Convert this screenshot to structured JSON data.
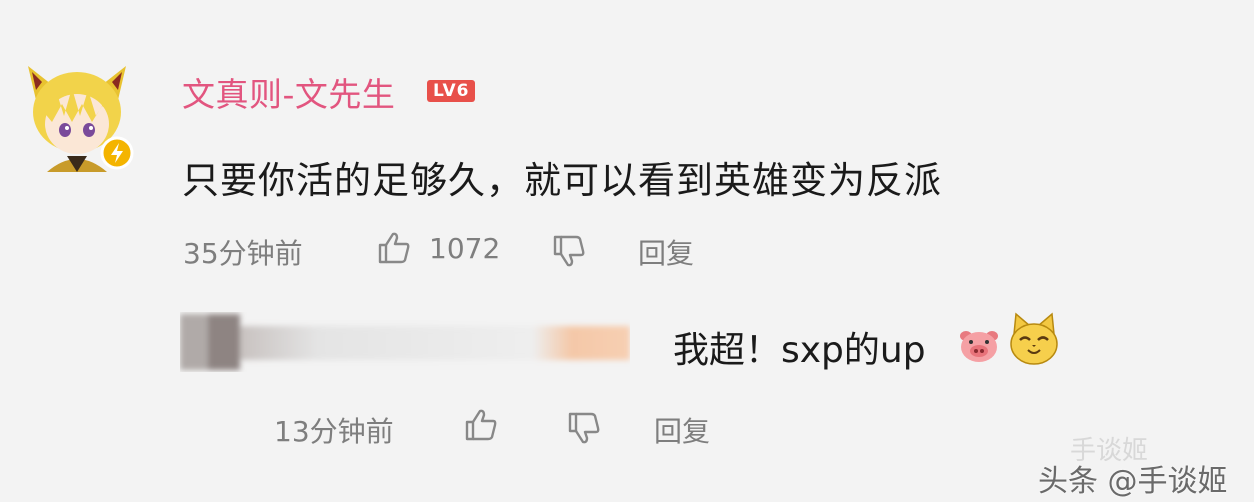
{
  "comment": {
    "username": "文真则-文先生",
    "level_badge": "LV6",
    "text": "只要你活的足够久，就可以看到英雄变为反派",
    "time": "35分钟前",
    "like_count": "1072",
    "reply_label": "回复"
  },
  "reply": {
    "text": "我超！sxp的up",
    "time": "13分钟前",
    "reply_label": "回复",
    "emojis": [
      "pig-face-emoji",
      "cat-face-emoji"
    ]
  },
  "watermark": {
    "secondary": "手谈姬",
    "main": "头条 @手谈姬"
  },
  "colors": {
    "background": "#f3f3f3",
    "username": "#e2557f",
    "level_badge": "#e8504a",
    "meta_text": "#7e7e7e",
    "verified_badge": "#f4b400"
  }
}
